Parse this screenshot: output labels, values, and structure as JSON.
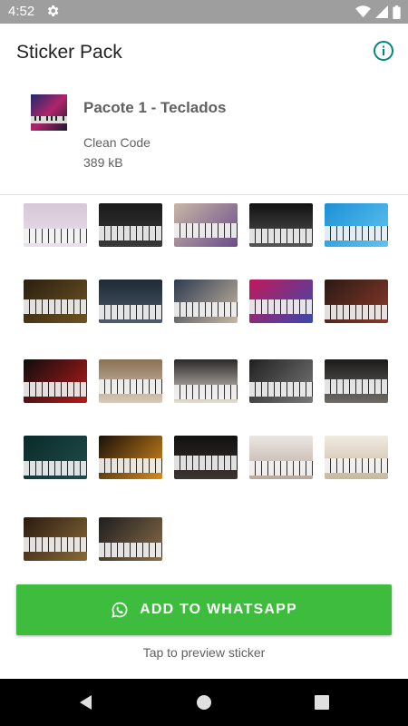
{
  "status_bar": {
    "time": "4:52",
    "icons": [
      "settings-icon",
      "wifi-icon",
      "signal-icon",
      "battery-icon"
    ]
  },
  "app_bar": {
    "title": "Sticker Pack",
    "info_icon": "info-icon"
  },
  "pack": {
    "name": "Pacote 1 - Teclados",
    "publisher": "Clean Code",
    "size": "389 kB",
    "tray_icon": "keyboard-tray-image"
  },
  "stickers": [
    {
      "name": "sticker-keyboard-1"
    },
    {
      "name": "sticker-keyboard-2"
    },
    {
      "name": "sticker-keyboard-3"
    },
    {
      "name": "sticker-keyboard-4"
    },
    {
      "name": "sticker-keyboard-5"
    },
    {
      "name": "sticker-keyboard-6"
    },
    {
      "name": "sticker-keyboard-7"
    },
    {
      "name": "sticker-keyboard-8"
    },
    {
      "name": "sticker-keyboard-9"
    },
    {
      "name": "sticker-keyboard-10"
    },
    {
      "name": "sticker-keyboard-11"
    },
    {
      "name": "sticker-keyboard-12"
    },
    {
      "name": "sticker-keyboard-13"
    },
    {
      "name": "sticker-keyboard-14"
    },
    {
      "name": "sticker-keyboard-15"
    },
    {
      "name": "sticker-keyboard-16"
    },
    {
      "name": "sticker-keyboard-17"
    },
    {
      "name": "sticker-keyboard-18"
    },
    {
      "name": "sticker-keyboard-19"
    },
    {
      "name": "sticker-keyboard-20"
    },
    {
      "name": "sticker-keyboard-21"
    },
    {
      "name": "sticker-keyboard-22"
    }
  ],
  "add_button": {
    "label": "ADD TO WHATSAPP",
    "icon": "whatsapp-icon"
  },
  "hint": "Tap to preview sticker",
  "nav_bar": {
    "back": "back-icon",
    "home": "home-icon",
    "recents": "recents-icon"
  },
  "colors": {
    "accent": "#3dbc3d",
    "info": "#00897b",
    "status_bar": "#9e9e9e"
  }
}
